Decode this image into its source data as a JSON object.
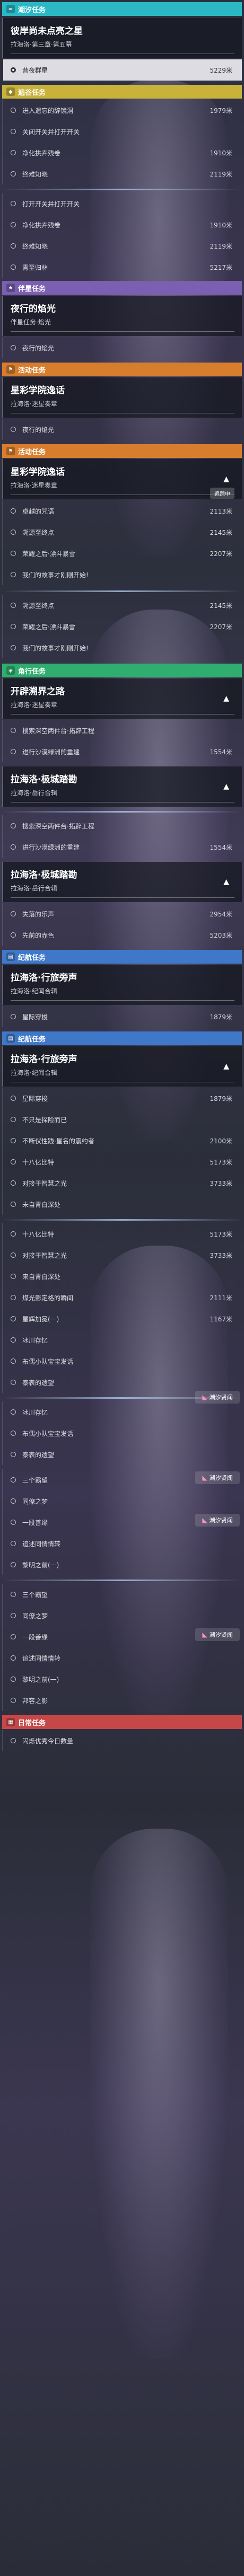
{
  "colors": {
    "cyan": "#2bb7c4",
    "yellow": "#c9b23a",
    "purple": "#7b5fb0",
    "orange": "#d77e2e",
    "green": "#2fae6f",
    "blue": "#3f78c8",
    "red": "#c64747"
  },
  "cats": {
    "chaoxi": "潮汐任务",
    "bianjing": "遍谷任务",
    "banxing": "伴星任务",
    "huodong": "活动任务",
    "jiaoxing": "角行任务",
    "jihang": "纪航任务",
    "richang": "日常任务"
  },
  "headers": {
    "h1": {
      "title": "彼岸尚未点亮之星",
      "sub": "拉海洛·第三章·第五幕"
    },
    "h2": {
      "title": "夜行的焰光",
      "sub": "伴星任务·焰光"
    },
    "h3": {
      "title": "星彩学院逸话",
      "sub": "拉海洛·迷星奏章"
    },
    "h4": {
      "title": "星彩学院逸话",
      "sub": "拉海洛·迷星奏章"
    },
    "h5": {
      "title": "开辟溯界之路",
      "sub": "拉海洛·迷星奏章"
    },
    "h6": {
      "title": "拉海洛·极城踏勘",
      "sub": "拉海洛·岳行合辑"
    },
    "h7": {
      "title": "拉海洛·极城踏勘",
      "sub": "拉海洛·岳行合辑"
    },
    "h8": {
      "title": "拉海洛·行旅旁声",
      "sub": "拉海洛·纪闻合辑"
    },
    "h9": {
      "title": "拉海洛·行旅旁声",
      "sub": "拉海洛·纪闻合辑"
    }
  },
  "items": [
    {
      "label": "昔夜群星",
      "dist": "5229米"
    },
    {
      "label": "进入遗忘的辞镜洞",
      "dist": "1979米"
    },
    {
      "label": "关闭开关并打开开关",
      "dist": ""
    },
    {
      "label": "净化拱卉残卷",
      "dist": "1910米"
    },
    {
      "label": "终难知晓",
      "dist": "2119米"
    },
    {
      "label": "打开开关并打开开关",
      "dist": ""
    },
    {
      "label": "净化拱卉残卷",
      "dist": "1910米"
    },
    {
      "label": "终难知晓",
      "dist": "2119米"
    },
    {
      "label": "青至归林",
      "dist": "5217米"
    },
    {
      "label": "夜行的焰光",
      "dist": ""
    },
    {
      "label": "夜行的焰光",
      "dist": ""
    },
    {
      "label": "卓越的咒语",
      "dist": "2113米"
    },
    {
      "label": "溯源至终点",
      "dist": "2145米"
    },
    {
      "label": "荣耀之后·漂斗暴雪",
      "dist": "2207米"
    },
    {
      "label": "我们的故事才刚刚开始!",
      "dist": ""
    },
    {
      "label": "溯源至终点",
      "dist": "2145米"
    },
    {
      "label": "荣耀之后·漂斗暴雪",
      "dist": "2207米"
    },
    {
      "label": "我们的故事才刚刚开始!",
      "dist": ""
    },
    {
      "label": "搜索深空两件台·拓辟工程",
      "dist": ""
    },
    {
      "label": "进行沙漠绿洲的重建",
      "dist": "1554米"
    },
    {
      "label": "搜索深空两件台·拓辟工程",
      "dist": ""
    },
    {
      "label": "进行沙漠绿洲的重建",
      "dist": "1554米"
    },
    {
      "label": "失落的乐声",
      "dist": "2954米"
    },
    {
      "label": "先前的赤色",
      "dist": "5203米"
    },
    {
      "label": "星际穿梭",
      "dist": "1879米"
    },
    {
      "label": "星际穿梭",
      "dist": "1879米"
    },
    {
      "label": "不只是探险而已",
      "dist": ""
    },
    {
      "label": "不断仪性践·星名的震约者",
      "dist": "2100米"
    },
    {
      "label": "十八亿比特",
      "dist": "5173米"
    },
    {
      "label": "对接于智慧之光",
      "dist": "3733米"
    },
    {
      "label": "未自青白深处",
      "dist": ""
    },
    {
      "label": "十八亿比特",
      "dist": "5173米"
    },
    {
      "label": "对接于智慧之光",
      "dist": "3733米"
    },
    {
      "label": "来自青白深处",
      "dist": ""
    },
    {
      "label": "煤光影定格的瞬间",
      "dist": "2111米"
    },
    {
      "label": "星辉加冕(一)",
      "dist": "1167米"
    },
    {
      "label": "冰川存忆",
      "dist": ""
    },
    {
      "label": "布偶小队宝宝发话",
      "dist": ""
    },
    {
      "label": "泰表的遗望",
      "dist": ""
    },
    {
      "label": "冰川存忆",
      "dist": ""
    },
    {
      "label": "布偶小队宝宝发话",
      "dist": ""
    },
    {
      "label": "泰表的遗望",
      "dist": ""
    },
    {
      "label": "三个霸望",
      "dist": ""
    },
    {
      "label": "同僚之梦",
      "dist": ""
    },
    {
      "label": "一段善缘",
      "dist": ""
    },
    {
      "label": "追述同情情转",
      "dist": ""
    },
    {
      "label": "黎明之前(一)",
      "dist": ""
    },
    {
      "label": "三个霸望",
      "dist": ""
    },
    {
      "label": "同僚之梦",
      "dist": ""
    },
    {
      "label": "一段善缘",
      "dist": ""
    },
    {
      "label": "追述同情情转",
      "dist": ""
    },
    {
      "label": "黎明之前(一)",
      "dist": ""
    },
    {
      "label": "邦容之影",
      "dist": ""
    },
    {
      "label": "闪烁优秀今日数量",
      "dist": ""
    }
  ],
  "flag_label": "潮汐贤闻",
  "tracked_label": "追踪中"
}
